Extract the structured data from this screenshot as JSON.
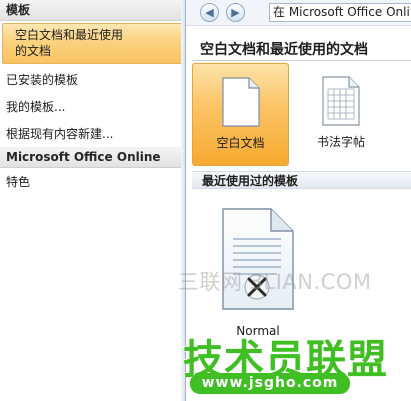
{
  "sidebar": {
    "header": "模板",
    "items": [
      {
        "label_line1": "空白文档和最近使用",
        "label_line2": "的文档",
        "selected": true
      },
      {
        "label": "已安装的模板"
      },
      {
        "label": "我的模板..."
      },
      {
        "label": "根据现有内容新建..."
      }
    ],
    "online_header": "Microsoft Office Online",
    "online_items": [
      {
        "label": "特色"
      }
    ]
  },
  "toolbar": {
    "back_icon": "back-arrow-icon",
    "forward_icon": "forward-arrow-icon",
    "search_text": "在 Microsoft Office Onli"
  },
  "main": {
    "title": "空白文档和最近使用的文档",
    "tiles": [
      {
        "label": "空白文档",
        "icon": "blank-document-icon",
        "selected": true
      },
      {
        "label": "书法字帖",
        "icon": "calligraphy-grid-icon",
        "selected": false
      }
    ],
    "recent_header": "最近使用过的模板",
    "recent": [
      {
        "label": "Normal",
        "icon": "template-document-icon"
      }
    ]
  },
  "watermarks": {
    "line1": "三联网 3LIAN.COM",
    "line2": "技术员联盟",
    "line3": "www.jsgho.com"
  },
  "colors": {
    "selected_accent": "#f9c463",
    "link_border": "#9fb3cc",
    "watermark_green": "#3fbf23"
  }
}
